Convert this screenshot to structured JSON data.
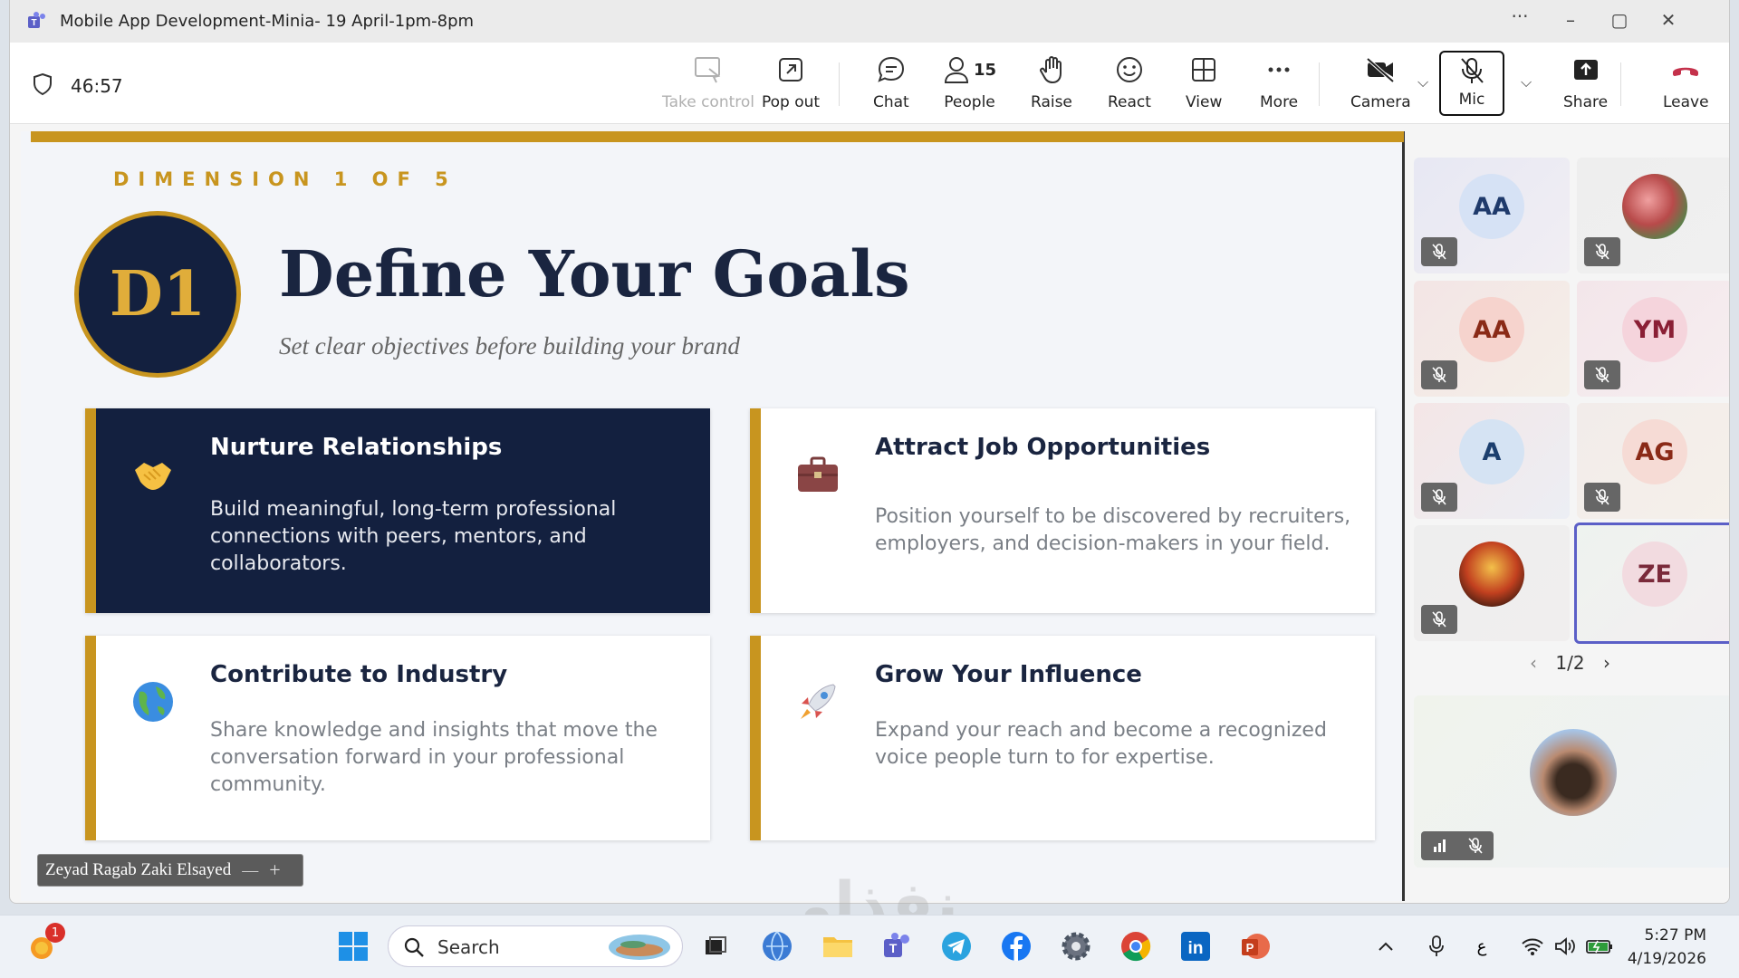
{
  "window": {
    "title": "Mobile App Development-Minia- 19 April-1pm-8pm"
  },
  "toolbar": {
    "timer": "46:57",
    "take_control": "Take control",
    "pop_out": "Pop out",
    "chat": "Chat",
    "people": "People",
    "people_count": "15",
    "raise": "Raise",
    "react": "React",
    "view": "View",
    "more": "More",
    "camera": "Camera",
    "mic": "Mic",
    "share": "Share",
    "leave": "Leave"
  },
  "slide": {
    "dimension": "DIMENSION 1 OF 5",
    "badge": "D1",
    "title": "Define Your Goals",
    "subtitle": "Set clear objectives before building your brand",
    "cards": [
      {
        "title": "Nurture Relationships",
        "desc": "Build meaningful, long-term professional connections with peers, mentors, and collaborators.",
        "icon": "handshake-emoji"
      },
      {
        "title": "Attract Job Opportunities",
        "desc": "Position yourself to be discovered by recruiters, employers, and decision-makers in your field.",
        "icon": "briefcase-emoji"
      },
      {
        "title": "Contribute to Industry",
        "desc": "Share knowledge and insights that move the conversation forward in your professional community.",
        "icon": "globe-emoji"
      },
      {
        "title": "Grow Your Influence",
        "desc": "Expand your reach and become a recognized voice people turn to for expertise.",
        "icon": "rocket-emoji"
      }
    ]
  },
  "presenter": {
    "name": "Zeyad Ragab Zaki Elsayed",
    "minus": "—",
    "plus": "+"
  },
  "gallery": {
    "tiles": [
      {
        "initials": "AA"
      },
      {
        "initials": ""
      },
      {
        "initials": "AA"
      },
      {
        "initials": "YM"
      },
      {
        "initials": "A"
      },
      {
        "initials": "AG"
      },
      {
        "initials": ""
      },
      {
        "initials": "ZE"
      }
    ],
    "page": "1/2"
  },
  "taskbar": {
    "search": "Search",
    "time": "5:27 PM",
    "date": "4/19/2026",
    "notif_count": "1",
    "lang": "ع"
  },
  "watermark": "نفذلي"
}
